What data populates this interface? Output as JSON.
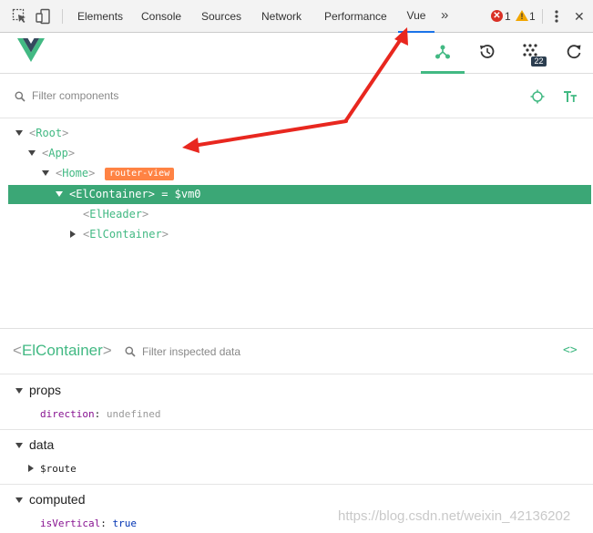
{
  "devtools": {
    "tabs": [
      "Elements",
      "Console",
      "Sources",
      "Network",
      "Performance",
      "Vue"
    ],
    "active_tab": "Vue",
    "more_tabs_glyph": "»",
    "errors": "1",
    "warnings": "1",
    "warning_glyph": "!",
    "error_glyph": "✕",
    "close_glyph": "✕"
  },
  "vue_header": {
    "tabs": [
      "components-icon",
      "history-icon",
      "vuex-icon",
      "refresh-icon"
    ],
    "events_count": "22",
    "accent": "#42b983"
  },
  "filter": {
    "placeholder": "Filter components"
  },
  "tree": {
    "nodes": [
      {
        "name": "Root",
        "expanded": true
      },
      {
        "name": "App",
        "expanded": true
      },
      {
        "name": "Home",
        "expanded": true,
        "badge": "router-view"
      },
      {
        "name": "ElContainer",
        "expanded": true,
        "selected": true,
        "ref": "= $vm0"
      },
      {
        "name": "ElHeader",
        "leaf": true
      },
      {
        "name": "ElContainer",
        "expanded": false
      }
    ]
  },
  "inspector": {
    "title": "ElContainer",
    "filter_placeholder": "Filter inspected data",
    "code_glyph": "<>",
    "sections": [
      {
        "title": "props",
        "items": [
          {
            "key": "direction",
            "value": "undefined"
          }
        ]
      },
      {
        "title": "data",
        "items": [
          {
            "key": "$route",
            "value": ""
          }
        ]
      },
      {
        "title": "computed",
        "items": [
          {
            "key": "isVertical",
            "value": "true"
          }
        ]
      }
    ]
  },
  "watermark": "https://blog.csdn.net/weixin_42136202",
  "colors": {
    "selected_row": "#3ba776",
    "router_badge": "#ff8344",
    "annotation_arrow": "#e8271f"
  }
}
